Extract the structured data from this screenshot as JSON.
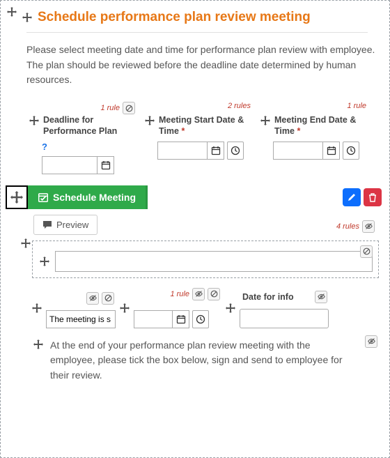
{
  "header": {
    "title": "Schedule performance plan review meeting",
    "description": "Please select meeting date and time for performance plan review with employee. The plan should be reviewed before the deadline date determined by human resources."
  },
  "fields": {
    "deadline": {
      "label": "Deadline for Performance Plan",
      "rules": "1 rule",
      "help": "?",
      "value": ""
    },
    "start": {
      "label": "Meeting Start Date & Time",
      "rules": "2 rules",
      "value": ""
    },
    "end": {
      "label": "Meeting End Date & Time",
      "rules": "1 rule",
      "value": ""
    }
  },
  "schedule_button": "Schedule Meeting",
  "preview": {
    "label": "Preview",
    "rules": "4 rules"
  },
  "row3": {
    "meeting_text": {
      "value": "The meeting is s"
    },
    "middle": {
      "rules": "1 rule",
      "value": ""
    },
    "date_info": {
      "label": "Date for info",
      "value": ""
    }
  },
  "footer_note": "At the end of your performance plan review meeting with the employee, please tick the box below, sign and send to employee for their review."
}
